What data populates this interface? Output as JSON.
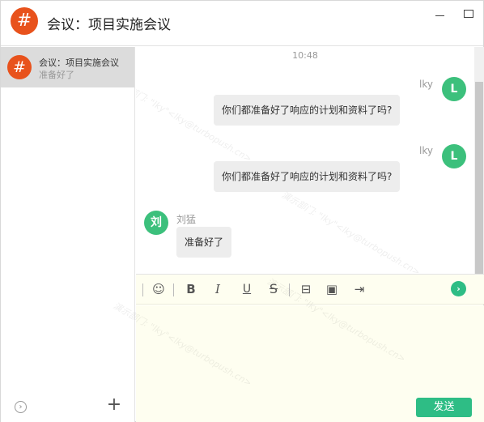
{
  "window": {
    "title": "会议：项目实施会议",
    "title_avatar_glyph": "#",
    "controls": {
      "minimize_icon": "minimize-icon",
      "maximize_icon": "maximize-icon"
    }
  },
  "sidebar": {
    "conversations": [
      {
        "avatar_glyph": "#",
        "title": "会议：项目实施会议",
        "preview": "准备好了",
        "selected": true
      }
    ],
    "footer": {
      "expand_icon": "›",
      "add_icon": "+"
    }
  },
  "chat": {
    "timestamp": "10:48",
    "messages": [
      {
        "sender": "lky",
        "avatar": "L",
        "side": "right",
        "text": "你们都准备好了响应的计划和资料了吗?"
      },
      {
        "sender": "lky",
        "avatar": "L",
        "side": "right",
        "text": "你们都准备好了响应的计划和资料了吗?"
      },
      {
        "sender": "刘猛",
        "avatar": "刘",
        "side": "left",
        "text": "准备好了"
      }
    ],
    "watermark": "演示部门: \"lky\"<lky@turbopush.cn>"
  },
  "toolbar": {
    "buttons": [
      {
        "name": "emoji-icon",
        "glyph": "☺"
      },
      {
        "name": "bold-button",
        "glyph": "B"
      },
      {
        "name": "italic-button",
        "glyph": "I"
      },
      {
        "name": "underline-button",
        "glyph": "U"
      },
      {
        "name": "strikethrough-button",
        "glyph": "S"
      },
      {
        "name": "briefcase-icon",
        "glyph": "⊟"
      },
      {
        "name": "image-icon",
        "glyph": "▣"
      },
      {
        "name": "export-icon",
        "glyph": "⇥"
      },
      {
        "name": "more-arrow-icon",
        "glyph": "›"
      }
    ]
  },
  "input": {
    "value": "",
    "send_label": "发送"
  },
  "colors": {
    "brand_orange": "#e8521c",
    "avatar_green": "#3cc07c",
    "send_green": "#2ebd85",
    "input_bg": "#fefef0",
    "selected_bg": "#dcdcdc",
    "bubble_bg": "#ededed"
  }
}
